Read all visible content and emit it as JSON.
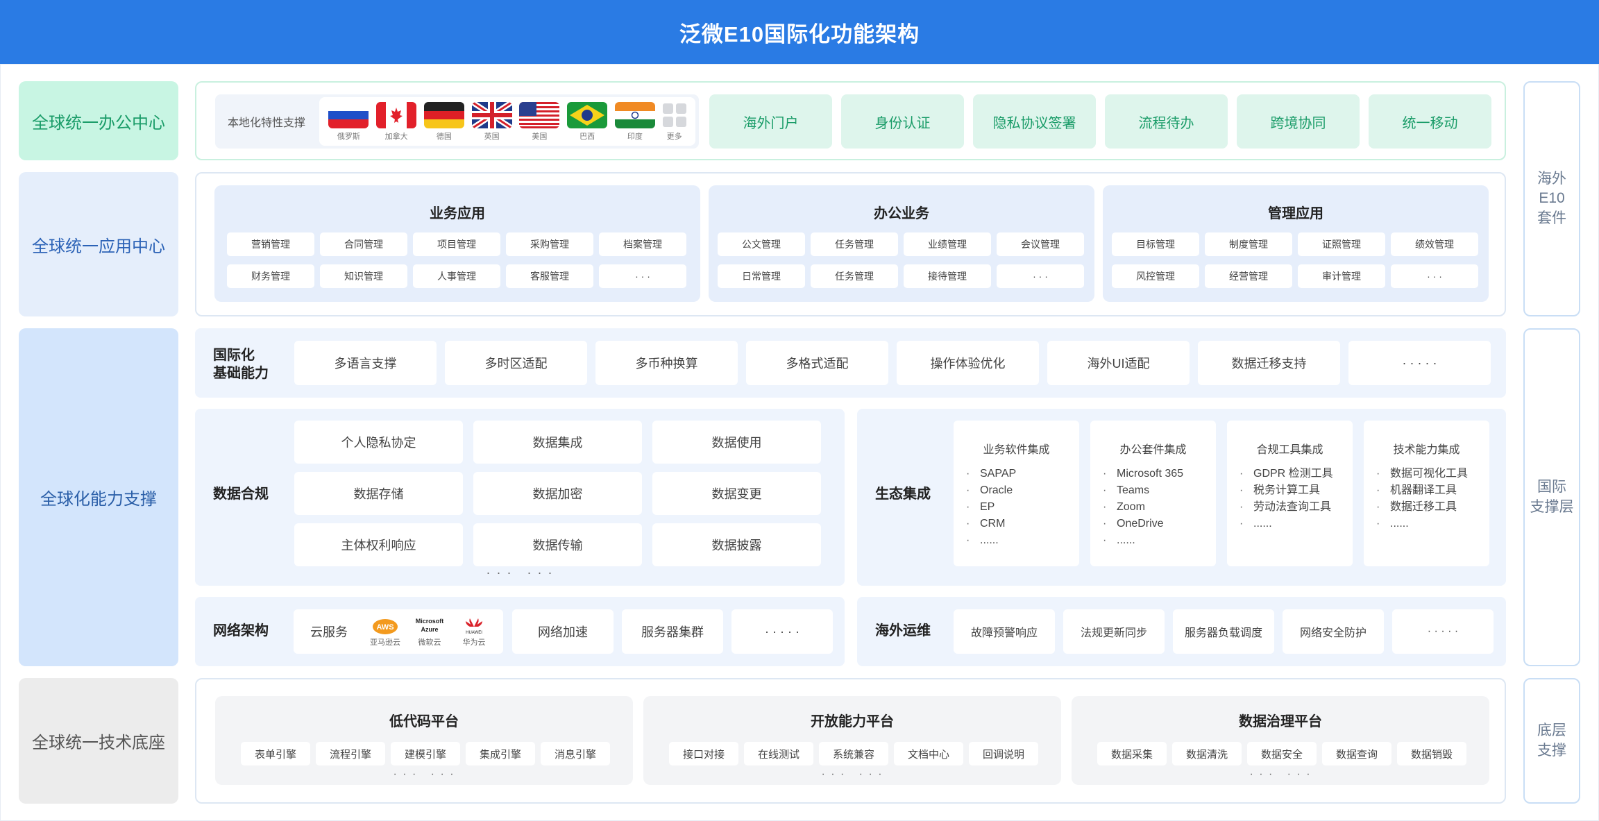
{
  "header": {
    "title": "泛微E10国际化功能架构"
  },
  "left_labels": {
    "office": "全球统一办公中心",
    "app": "全球统一应用中心",
    "capability": "全球化能力支撑",
    "tech": "全球统一技术底座"
  },
  "right_labels": {
    "e10": "海外\nE10\n套件",
    "intl": "国际\n支撑层",
    "base": "底层\n支撑"
  },
  "office_center": {
    "localization_label": "本地化特性支撑",
    "countries": [
      "俄罗斯",
      "加拿大",
      "德国",
      "英国",
      "美国",
      "巴西",
      "印度",
      "更多"
    ],
    "features": [
      "海外门户",
      "身份认证",
      "隐私协议签署",
      "流程待办",
      "跨境协同",
      "统一移动"
    ]
  },
  "app_center": {
    "groups": [
      {
        "title": "业务应用",
        "items": [
          "营销管理",
          "合同管理",
          "项目管理",
          "采购管理",
          "档案管理",
          "财务管理",
          "知识管理",
          "人事管理",
          "客服管理",
          "· · ·"
        ]
      },
      {
        "title": "办公业务",
        "items": [
          "公文管理",
          "任务管理",
          "业绩管理",
          "会议管理",
          "日常管理",
          "任务管理",
          "接待管理",
          "· · ·"
        ]
      },
      {
        "title": "管理应用",
        "items": [
          "目标管理",
          "制度管理",
          "证照管理",
          "绩效管理",
          "风控管理",
          "经营管理",
          "审计管理",
          "· · ·"
        ]
      }
    ]
  },
  "intl_basic": {
    "label": "国际化\n基础能力",
    "items": [
      "多语言支撑",
      "多时区适配",
      "多币种换算",
      "多格式适配",
      "操作体验优化",
      "海外UI适配",
      "数据迁移支持",
      "· · · · ·"
    ]
  },
  "data_compliance": {
    "label": "数据合规",
    "items": [
      "个人隐私协定",
      "数据集成",
      "数据使用",
      "数据存储",
      "数据加密",
      "数据变更",
      "主体权利响应",
      "数据传输",
      "数据披露"
    ],
    "more": "· · ·   · · ·"
  },
  "ecosystem": {
    "label": "生态集成",
    "cards": [
      {
        "title": "业务软件集成",
        "items": [
          "SAPAP",
          "Oracle",
          "EP",
          "CRM",
          "......"
        ]
      },
      {
        "title": "办公套件集成",
        "items": [
          "Microsoft 365",
          "Teams",
          "Zoom",
          "OneDrive",
          "......"
        ]
      },
      {
        "title": "合规工具集成",
        "items": [
          "GDPR 检测工具",
          "税务计算工具",
          "劳动法查询工具",
          "......"
        ]
      },
      {
        "title": "技术能力集成",
        "items": [
          "数据可视化工具",
          "机器翻译工具",
          "数据迁移工具",
          "......"
        ]
      }
    ]
  },
  "network": {
    "label": "网络架构",
    "cloud_label": "云服务",
    "clouds": [
      {
        "logo": "AWS",
        "name": "亚马逊云"
      },
      {
        "logo": "Microsoft Azure",
        "name": "微软云"
      },
      {
        "logo": "HUAWEI",
        "name": "华为云"
      }
    ],
    "items": [
      "网络加速",
      "服务器集群",
      "· · · · ·"
    ]
  },
  "ops": {
    "label": "海外运维",
    "items": [
      "故障预警响应",
      "法规更新同步",
      "服务器负载调度",
      "网络安全防护",
      "· · · · ·"
    ]
  },
  "tech_base": {
    "platforms": [
      {
        "title": "低代码平台",
        "items": [
          "表单引擎",
          "流程引擎",
          "建模引擎",
          "集成引擎",
          "消息引擎"
        ],
        "more": "· · ·   · · ·"
      },
      {
        "title": "开放能力平台",
        "items": [
          "接口对接",
          "在线测试",
          "系统兼容",
          "文档中心",
          "回调说明"
        ],
        "more": "· · ·   · · ·"
      },
      {
        "title": "数据治理平台",
        "items": [
          "数据采集",
          "数据清洗",
          "数据安全",
          "数据查询",
          "数据销毁"
        ],
        "more": "· · ·   · · ·"
      }
    ]
  },
  "colors": {
    "header": "#2a7be4",
    "office_accent": "#1a9c68",
    "app_accent": "#2b62b6"
  }
}
